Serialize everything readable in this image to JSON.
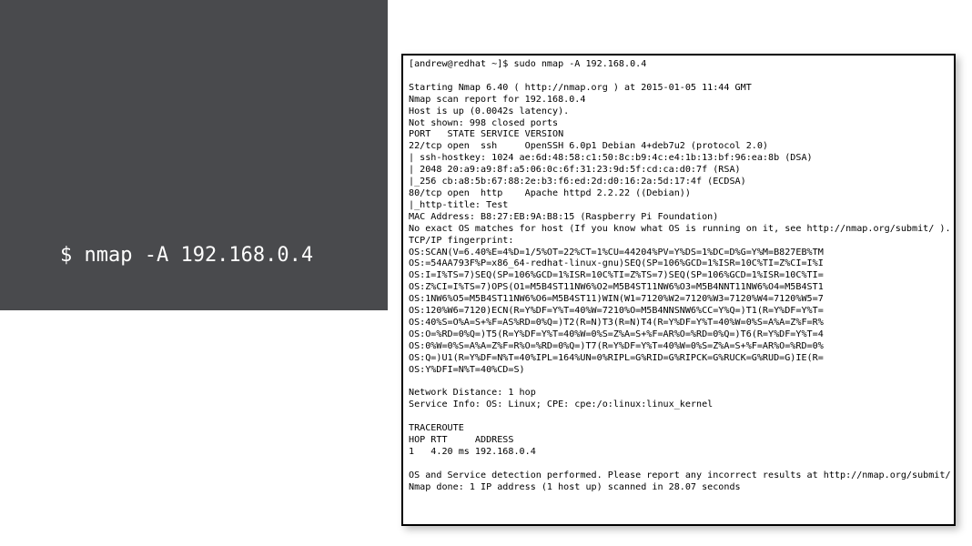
{
  "left_command": "$ nmap -A 192.168.0.4",
  "terminal_output": "[andrew@redhat ~]$ sudo nmap -A 192.168.0.4\n\nStarting Nmap 6.40 ( http://nmap.org ) at 2015-01-05 11:44 GMT\nNmap scan report for 192.168.0.4\nHost is up (0.0042s latency).\nNot shown: 998 closed ports\nPORT   STATE SERVICE VERSION\n22/tcp open  ssh     OpenSSH 6.0p1 Debian 4+deb7u2 (protocol 2.0)\n| ssh-hostkey: 1024 ae:6d:48:58:c1:50:8c:b9:4c:e4:1b:13:bf:96:ea:8b (DSA)\n| 2048 20:a9:a9:8f:a5:06:0c:6f:31:23:9d:5f:cd:ca:d0:7f (RSA)\n|_256 cb:a8:5b:67:88:2e:b3:f6:ed:2d:d0:16:2a:5d:17:4f (ECDSA)\n80/tcp open  http    Apache httpd 2.2.22 ((Debian))\n|_http-title: Test\nMAC Address: B8:27:EB:9A:B8:15 (Raspberry Pi Foundation)\nNo exact OS matches for host (If you know what OS is running on it, see http://nmap.org/submit/ ).\nTCP/IP fingerprint:\nOS:SCAN(V=6.40%E=4%D=1/5%OT=22%CT=1%CU=44204%PV=Y%DS=1%DC=D%G=Y%M=B827EB%TM\nOS:=54AA793F%P=x86_64-redhat-linux-gnu)SEQ(SP=106%GCD=1%ISR=10C%TI=Z%CI=I%I\nOS:I=I%TS=7)SEQ(SP=106%GCD=1%ISR=10C%TI=Z%TS=7)SEQ(SP=106%GCD=1%ISR=10C%TI=\nOS:Z%CI=I%TS=7)OPS(O1=M5B4ST11NW6%O2=M5B4ST11NW6%O3=M5B4NNT11NW6%O4=M5B4ST1\nOS:1NW6%O5=M5B4ST11NW6%O6=M5B4ST11)WIN(W1=7120%W2=7120%W3=7120%W4=7120%W5=7\nOS:120%W6=7120)ECN(R=Y%DF=Y%T=40%W=7210%O=M5B4NNSNW6%CC=Y%Q=)T1(R=Y%DF=Y%T=\nOS:40%S=O%A=S+%F=AS%RD=0%Q=)T2(R=N)T3(R=N)T4(R=Y%DF=Y%T=40%W=0%S=A%A=Z%F=R%\nOS:O=%RD=0%Q=)T5(R=Y%DF=Y%T=40%W=0%S=Z%A=S+%F=AR%O=%RD=0%Q=)T6(R=Y%DF=Y%T=4\nOS:0%W=0%S=A%A=Z%F=R%O=%RD=0%Q=)T7(R=Y%DF=Y%T=40%W=0%S=Z%A=S+%F=AR%O=%RD=0%\nOS:Q=)U1(R=Y%DF=N%T=40%IPL=164%UN=0%RIPL=G%RID=G%RIPCK=G%RUCK=G%RUD=G)IE(R=\nOS:Y%DFI=N%T=40%CD=S)\n\nNetwork Distance: 1 hop\nService Info: OS: Linux; CPE: cpe:/o:linux:linux_kernel\n\nTRACEROUTE\nHOP RTT     ADDRESS\n1   4.20 ms 192.168.0.4\n\nOS and Service detection performed. Please report any incorrect results at http://nmap.org/submit/ .\nNmap done: 1 IP address (1 host up) scanned in 28.07 seconds"
}
